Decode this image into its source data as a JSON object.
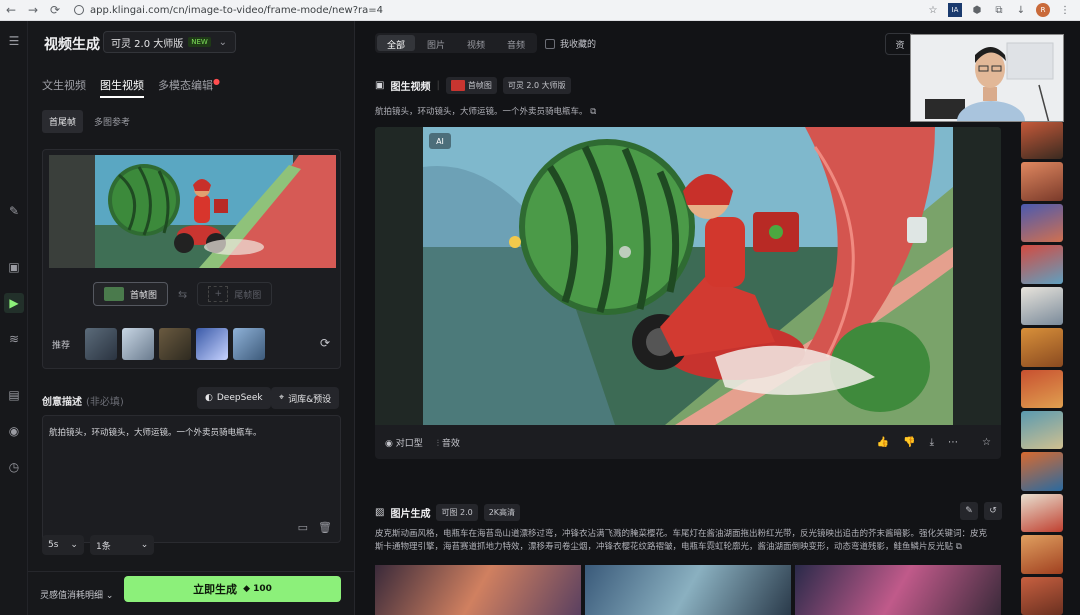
{
  "browser": {
    "url": "app.klingai.com/cn/image-to-video/frame-mode/new?ra=4",
    "nav": [
      "←",
      "→",
      "⟳"
    ],
    "profile_initial": "R"
  },
  "left_panel": {
    "title": "视频生成",
    "model": {
      "label": "可灵 2.0 大师版",
      "badge": "NEW"
    },
    "tabs": [
      {
        "label": "文生视频"
      },
      {
        "label": "图生视频"
      },
      {
        "label": "多模态编辑"
      }
    ],
    "subtabs": [
      {
        "label": "首尾帧"
      },
      {
        "label": "多图参考"
      }
    ],
    "frame_buttons": {
      "first": "首帧图",
      "last": "尾帧图"
    },
    "recommend_label": "推荐",
    "description": {
      "label": "创意描述",
      "optional": "(非必填)",
      "deepseek": "DeepSeek",
      "library": "词库&预设",
      "text": "航拍镜头，环动镜头，大师运镜。一个外卖员骑电瓶车。"
    },
    "duration": "5s",
    "count": "1条",
    "spend_label": "灵感值消耗明细",
    "generate": {
      "label": "立即生成",
      "cost": "100"
    }
  },
  "main": {
    "filters": [
      {
        "label": "全部"
      },
      {
        "label": "图片"
      },
      {
        "label": "视频"
      },
      {
        "label": "音频"
      }
    ],
    "favorites_label": "我收藏的",
    "asset_label": "资",
    "section1": {
      "title": "图生视频",
      "chip_frame": "首帧图",
      "chip_model": "可灵 2.0 大师版",
      "prompt": "航拍镜头，环动镜头，大师运镜。一个外卖员骑电瓶车。",
      "ai_badge": "AI",
      "lip_sync": "对口型",
      "sound_effect": "音效"
    },
    "section2": {
      "title": "图片生成",
      "chip_model": "可图 2.0",
      "chip_res": "2K高清",
      "prompt": "皮克斯动画风格，电瓶车在海苔岛山道漂移过弯，冲锋衣沾满飞溅的腌菜樱花。车尾灯在酱油湖面拖出粉红光带，反光镜映出追击的芥末酱暗影。强化关键词：皮克斯卡通物理引擎，海苔赛道抓地力特效，漂移寿司卷尘烟，冲锋衣樱花纹路褶皱，电瓶车霓虹轮廓光，酱油湖面倒映变形，动态弯道残影，鲑鱼鳞片反光贴"
    }
  },
  "colors": {
    "accent_green": "#8cf07a",
    "background": "#121316",
    "panel": "#17181b"
  }
}
